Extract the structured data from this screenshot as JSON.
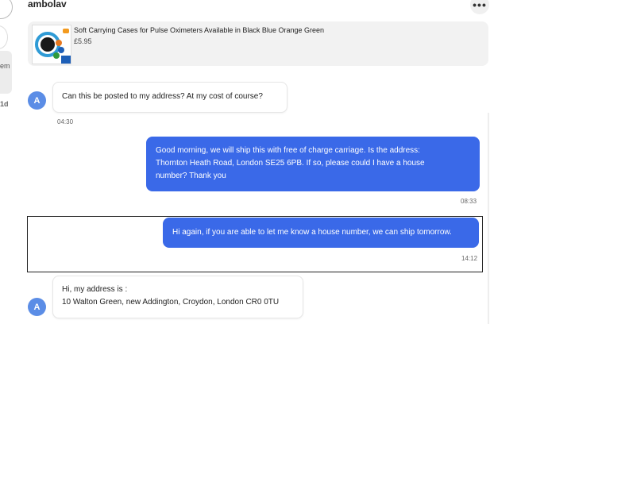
{
  "sidebar": {
    "partial_label": "em",
    "partial_time": "1d"
  },
  "header": {
    "username": "ambolav",
    "more_icon": "more-horizontal-icon"
  },
  "product": {
    "title": "Soft Carrying Cases for Pulse Oximeters Available in Black Blue Orange Green",
    "price": "£5.95"
  },
  "messages": [
    {
      "direction": "incoming",
      "avatar": "A",
      "lines": [
        "Can this be posted to my address? At my cost of course?"
      ],
      "time": "04:30"
    },
    {
      "direction": "outgoing",
      "lines": [
        "Good morning, we will ship this with free of charge carriage. Is the address:",
        "Thornton Heath Road, London SE25 6PB. If so, please could I have a house",
        "number? Thank you"
      ],
      "time": "08:33"
    },
    {
      "direction": "outgoing",
      "lines": [
        "Hi again, if you are able to let me know a house number, we can ship tomorrow."
      ],
      "time": "14:12"
    },
    {
      "direction": "incoming",
      "avatar": "A",
      "lines": [
        "Hi, my address is :",
        "10 Walton Green, new Addington, Croydon, London CR0 0TU"
      ],
      "time": ""
    }
  ]
}
